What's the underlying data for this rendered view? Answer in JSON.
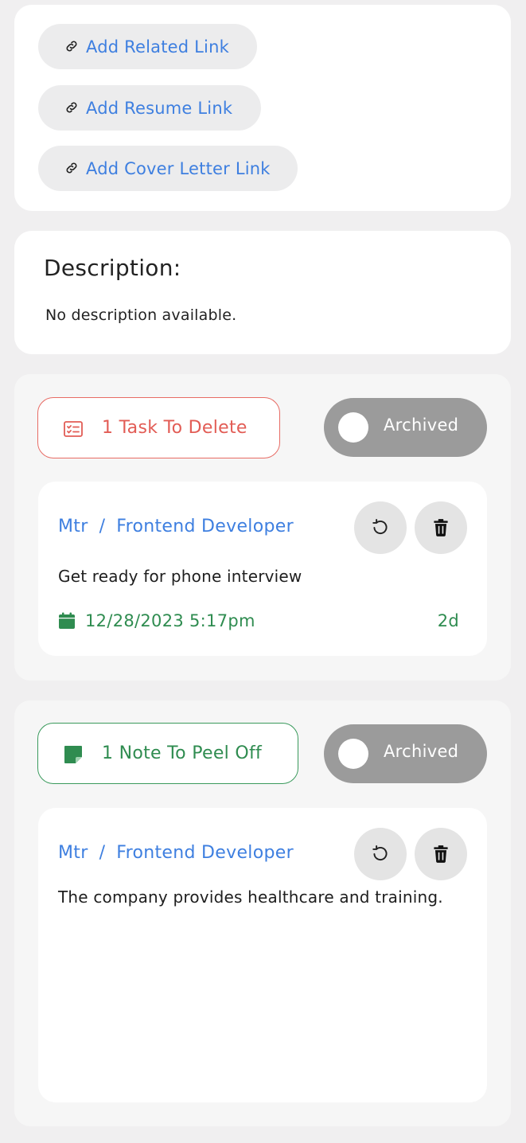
{
  "links": {
    "related_label": "Add Related Link",
    "resume_label": "Add Resume Link",
    "cover_label": "Add Cover Letter Link"
  },
  "description": {
    "title": "Description:",
    "text": "No description available."
  },
  "tasks": {
    "count_label": "1 Task To Delete",
    "toggle_label": "Archived",
    "items": [
      {
        "company": "Mtr",
        "separator": "/",
        "role": "Frontend Developer",
        "text": "Get ready for phone interview",
        "due": "12/28/2023 5:17pm",
        "relative": "2d"
      }
    ]
  },
  "notes": {
    "count_label": "1 Note To Peel Off",
    "toggle_label": "Archived",
    "items": [
      {
        "company": "Mtr",
        "separator": "/",
        "role": "Frontend Developer",
        "text": "The company provides healthcare and training."
      }
    ]
  },
  "icons": {
    "link": "link-icon",
    "task": "task-list-icon",
    "note": "sticky-note-icon",
    "restore": "restore-icon",
    "delete": "trash-icon",
    "calendar": "calendar-icon"
  },
  "colors": {
    "link_blue": "#3e7fe0",
    "task_red": "#e25c55",
    "note_green": "#2f8c50",
    "toggle_gray": "#9b9b9b"
  }
}
